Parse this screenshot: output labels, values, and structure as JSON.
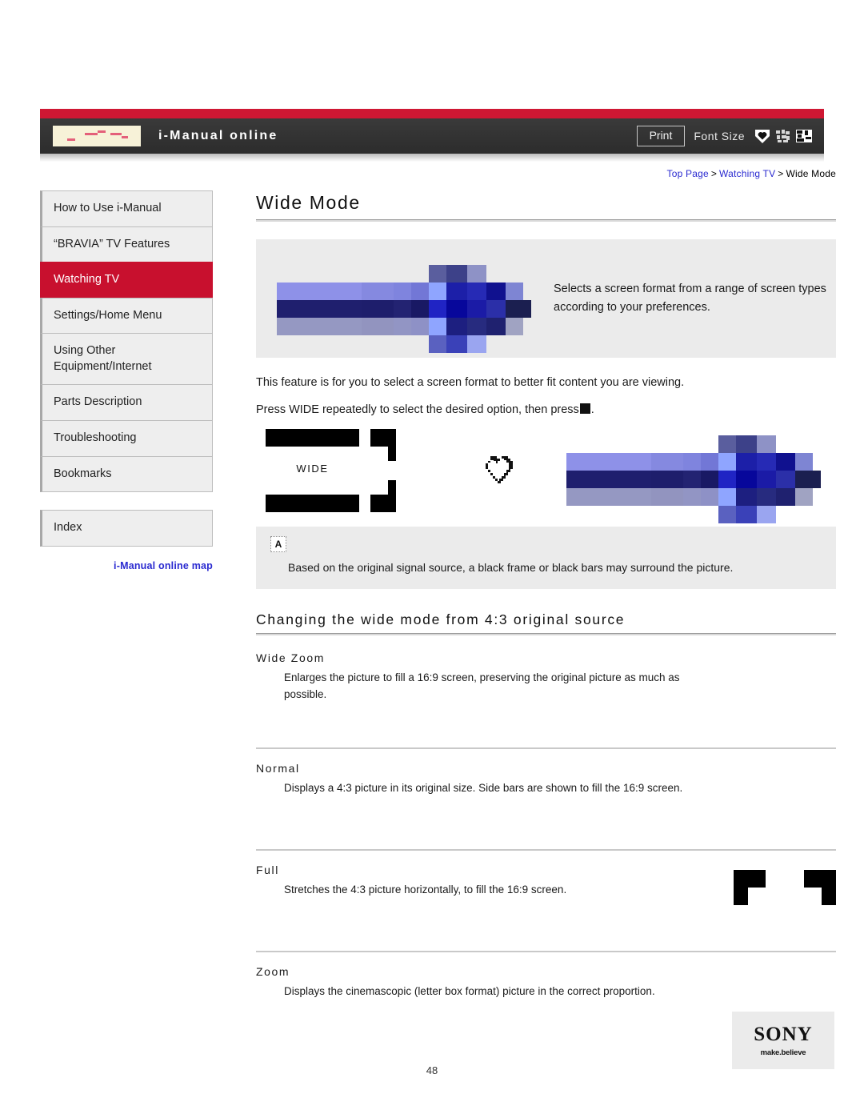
{
  "header": {
    "site_title": "i-Manual online",
    "print_label": "Print",
    "font_size_label": "Font Size",
    "logo_name": "i-manual-logo",
    "font_icons": [
      "font-size-small-icon",
      "font-size-medium-icon",
      "font-size-large-icon"
    ],
    "accent_red": "#cf1733",
    "bar_dark": "#333333"
  },
  "sidebar": {
    "items": [
      {
        "label": "How to Use i-Manual",
        "active": false
      },
      {
        "label": "“BRAVIA” TV Features",
        "active": false
      },
      {
        "label": "Watching TV",
        "active": true
      },
      {
        "label": "Settings/Home Menu",
        "active": false
      },
      {
        "label": "Using Other Equipment/Internet",
        "active": false
      },
      {
        "label": "Parts Description",
        "active": false
      },
      {
        "label": "Troubleshooting",
        "active": false
      },
      {
        "label": "Bookmarks",
        "active": false
      }
    ],
    "index_label": "Index",
    "map_link": "i-Manual online map",
    "active_color": "#c8102e",
    "link_color": "#2a2ad0"
  },
  "breadcrumb": {
    "top_page": "Top Page",
    "section": "Watching TV",
    "current": "Wide Mode",
    "separator": ">"
  },
  "main": {
    "page_title": "Wide Mode",
    "hero_text": "Selects a screen format from a range of screen types according to your preferences.",
    "intro_line1": "This feature is for you to select a screen format to better fit content you are viewing.",
    "intro_line2_before": "Press WIDE repeatedly to select the desired option, then press",
    "intro_line2_after": ".",
    "wide_button_label": "WIDE",
    "note_badge": "A",
    "note_text": "Based on the original signal source, a black frame or black bars may surround the picture.",
    "section_title": "Changing the wide mode from 4:3 original source",
    "subsections": [
      {
        "title": "Wide Zoom",
        "body": "Enlarges the picture to fill a 16:9 screen, preserving the original picture as much as possible."
      },
      {
        "title": "Normal",
        "body": "Displays a 4:3 picture in its original size. Side bars are shown to fill the 16:9 screen."
      },
      {
        "title": "Full",
        "body": "Stretches the 4:3 picture horizontally, to fill the 16:9 screen."
      },
      {
        "title": "Zoom",
        "body": "Displays the cinemascopic (letter box format) picture in the correct proportion."
      }
    ]
  },
  "footer": {
    "brand": "SONY",
    "tagline": "make.believe",
    "page_number": "48"
  }
}
